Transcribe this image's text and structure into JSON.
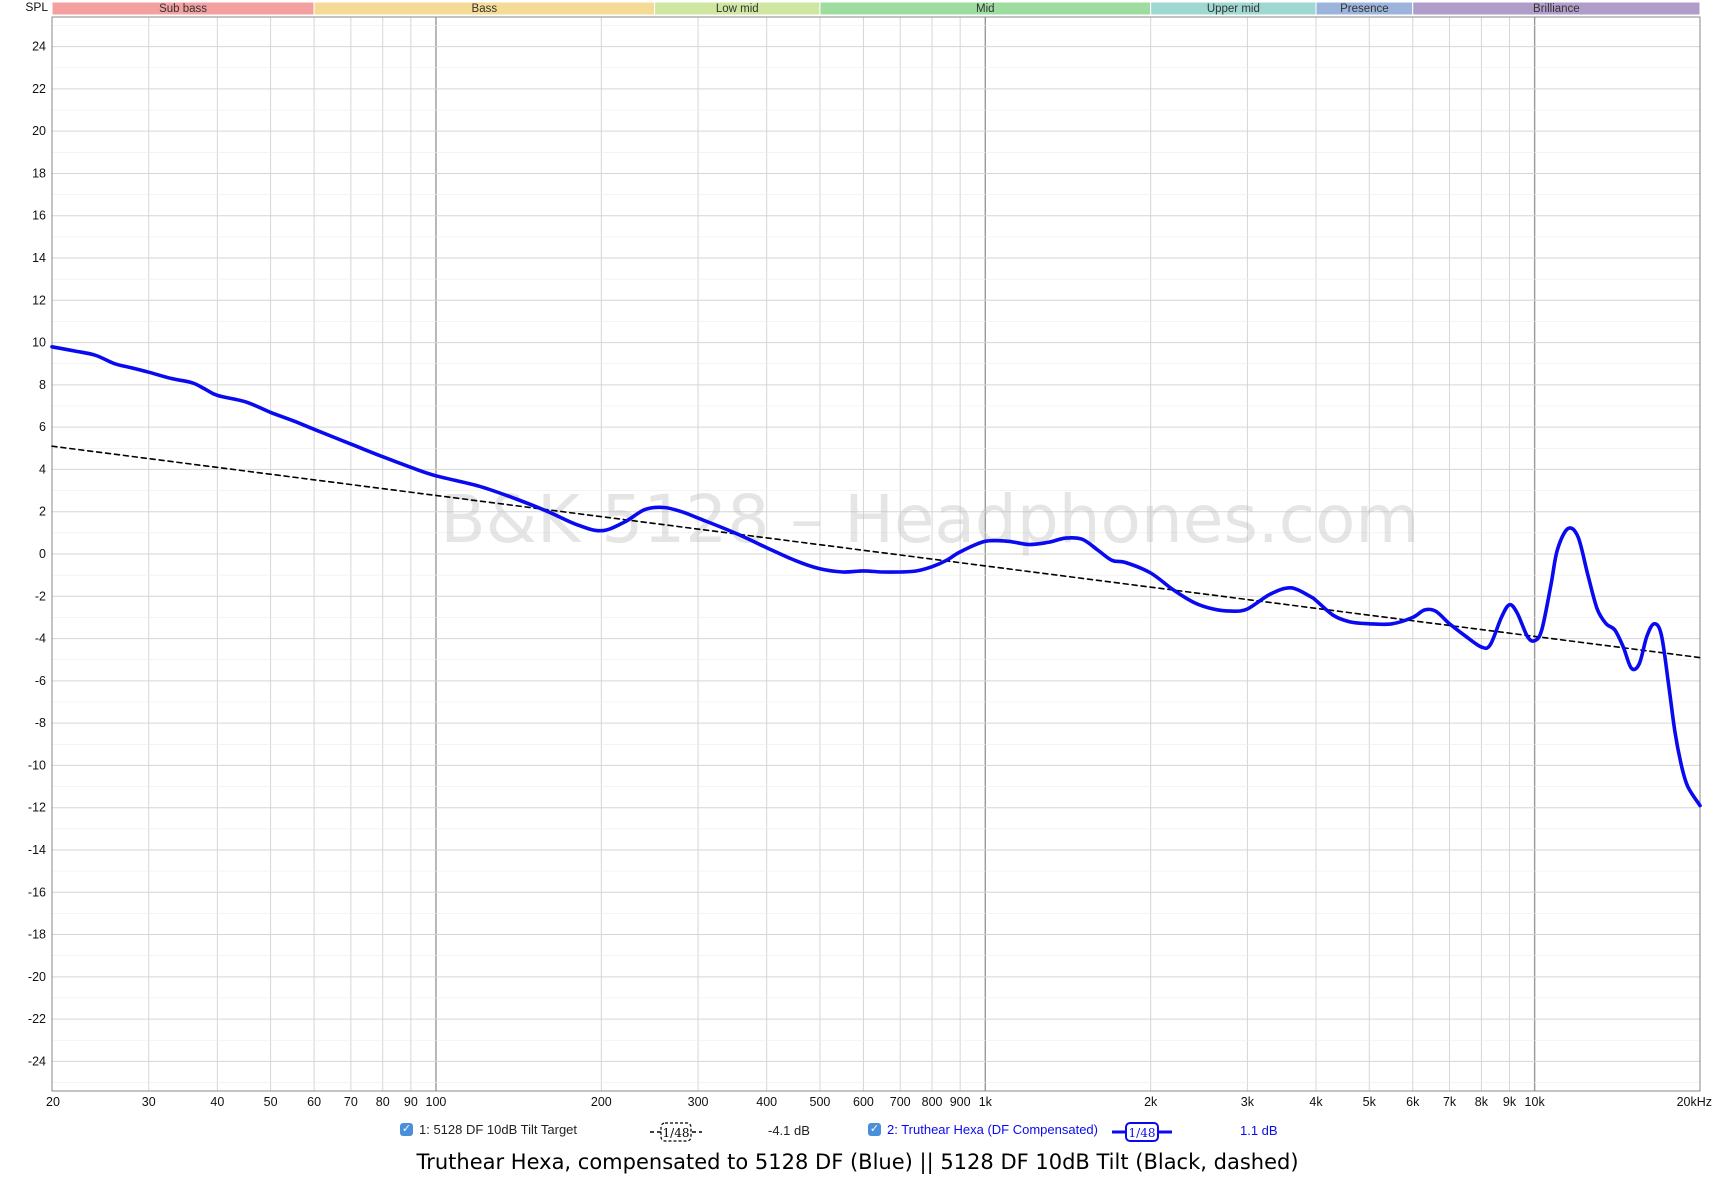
{
  "chart_data": {
    "type": "line",
    "title": "Truthear Hexa, compensated to 5128 DF (Blue) || 5128 DF 10dB Tilt (Black, dashed)",
    "ylabel": "SPL",
    "xscale": "log",
    "xlim": [
      20,
      20000
    ],
    "ylim": [
      -25,
      25
    ],
    "yticks": [
      24,
      22,
      20,
      18,
      16,
      14,
      12,
      10,
      8,
      6,
      4,
      2,
      0,
      -2,
      -4,
      -6,
      -8,
      -10,
      -12,
      -14,
      -16,
      -18,
      -20,
      -22,
      -24
    ],
    "xticks": [
      {
        "f": 20,
        "label": "20"
      },
      {
        "f": 30,
        "label": "30"
      },
      {
        "f": 40,
        "label": "40"
      },
      {
        "f": 50,
        "label": "50"
      },
      {
        "f": 60,
        "label": "60"
      },
      {
        "f": 70,
        "label": "70"
      },
      {
        "f": 80,
        "label": "80"
      },
      {
        "f": 90,
        "label": "90"
      },
      {
        "f": 100,
        "label": "100"
      },
      {
        "f": 200,
        "label": "200"
      },
      {
        "f": 300,
        "label": "300"
      },
      {
        "f": 400,
        "label": "400"
      },
      {
        "f": 500,
        "label": "500"
      },
      {
        "f": 600,
        "label": "600"
      },
      {
        "f": 700,
        "label": "700"
      },
      {
        "f": 800,
        "label": "800"
      },
      {
        "f": 900,
        "label": "900"
      },
      {
        "f": 1000,
        "label": "1k"
      },
      {
        "f": 2000,
        "label": "2k"
      },
      {
        "f": 3000,
        "label": "3k"
      },
      {
        "f": 4000,
        "label": "4k"
      },
      {
        "f": 5000,
        "label": "5k"
      },
      {
        "f": 6000,
        "label": "6k"
      },
      {
        "f": 7000,
        "label": "7k"
      },
      {
        "f": 8000,
        "label": "8k"
      },
      {
        "f": 9000,
        "label": "9k"
      },
      {
        "f": 10000,
        "label": "10k"
      },
      {
        "f": 20000,
        "label": "20kHz"
      }
    ],
    "grid": true,
    "bands": [
      {
        "label": "Sub bass",
        "from": 20,
        "to": 60,
        "color": "#f4a0a0"
      },
      {
        "label": "Bass",
        "from": 60,
        "to": 250,
        "color": "#f4dc96"
      },
      {
        "label": "Low mid",
        "from": 250,
        "to": 500,
        "color": "#cfe6a0"
      },
      {
        "label": "Mid",
        "from": 500,
        "to": 2000,
        "color": "#9edca0"
      },
      {
        "label": "Upper mid",
        "from": 2000,
        "to": 4000,
        "color": "#9ed8d0"
      },
      {
        "label": "Presence",
        "from": 4000,
        "to": 6000,
        "color": "#9cb4dc"
      },
      {
        "label": "Brilliance",
        "from": 6000,
        "to": 20000,
        "color": "#b09cc8"
      }
    ],
    "watermark": "B&K 5128 – Headphones.com",
    "series": [
      {
        "name": "1: 5128 DF 10dB Tilt Target",
        "color": "#000000",
        "dashed": true,
        "x": [
          20,
          20000
        ],
        "y": [
          5.1,
          -4.9
        ]
      },
      {
        "name": "2: Truthear Hexa (DF Compensated)",
        "color": "#0a0af0",
        "dashed": false,
        "x": [
          20,
          22,
          24,
          26,
          28,
          30,
          33,
          36,
          38,
          40,
          45,
          50,
          55,
          60,
          70,
          80,
          90,
          100,
          120,
          140,
          160,
          180,
          200,
          220,
          240,
          260,
          280,
          300,
          350,
          400,
          450,
          500,
          550,
          600,
          650,
          700,
          750,
          800,
          850,
          900,
          1000,
          1100,
          1200,
          1300,
          1400,
          1500,
          1600,
          1700,
          1800,
          2000,
          2200,
          2400,
          2600,
          2800,
          3000,
          3300,
          3600,
          3900,
          4000,
          4300,
          4600,
          5000,
          5500,
          6000,
          6300,
          6600,
          7000,
          7500,
          8000,
          8300,
          8700,
          9000,
          9300,
          9700,
          10000,
          10300,
          10700,
          11000,
          11500,
          12000,
          12500,
          13000,
          13500,
          14000,
          14500,
          15000,
          15500,
          16000,
          16500,
          17000,
          17500,
          18000,
          18500,
          19000,
          20000
        ],
        "y": [
          9.8,
          9.6,
          9.4,
          9.0,
          8.8,
          8.6,
          8.3,
          8.1,
          7.8,
          7.5,
          7.2,
          6.7,
          6.3,
          5.9,
          5.2,
          4.6,
          4.1,
          3.7,
          3.2,
          2.6,
          2.0,
          1.4,
          1.1,
          1.5,
          2.1,
          2.2,
          2.0,
          1.7,
          1.0,
          0.3,
          -0.3,
          -0.7,
          -0.85,
          -0.8,
          -0.85,
          -0.85,
          -0.8,
          -0.6,
          -0.3,
          0.1,
          0.6,
          0.6,
          0.45,
          0.55,
          0.75,
          0.7,
          0.2,
          -0.3,
          -0.4,
          -0.9,
          -1.7,
          -2.3,
          -2.6,
          -2.7,
          -2.6,
          -1.9,
          -1.6,
          -2.0,
          -2.2,
          -2.9,
          -3.2,
          -3.3,
          -3.3,
          -3.0,
          -2.65,
          -2.7,
          -3.3,
          -3.9,
          -4.4,
          -4.3,
          -3.0,
          -2.4,
          -2.8,
          -3.9,
          -4.1,
          -3.6,
          -1.5,
          0.2,
          1.2,
          0.8,
          -1.0,
          -2.6,
          -3.3,
          -3.6,
          -4.4,
          -5.4,
          -5.2,
          -3.9,
          -3.3,
          -3.8,
          -6.0,
          -8.4,
          -10.0,
          -11.0,
          -11.9
        ]
      }
    ]
  },
  "legend": {
    "items": [
      {
        "label": "1: 5128 DF 10dB Tilt Target",
        "smoothing": "1/48",
        "db": "-4.1 dB",
        "color": "#222222"
      },
      {
        "label": "2: Truthear Hexa (DF Compensated)",
        "smoothing": "1/48",
        "db": "1.1 dB",
        "color": "#0a0af0"
      }
    ]
  },
  "caption": "Truthear Hexa, compensated to 5128 DF (Blue) || 5128 DF 10dB Tilt (Black, dashed)"
}
